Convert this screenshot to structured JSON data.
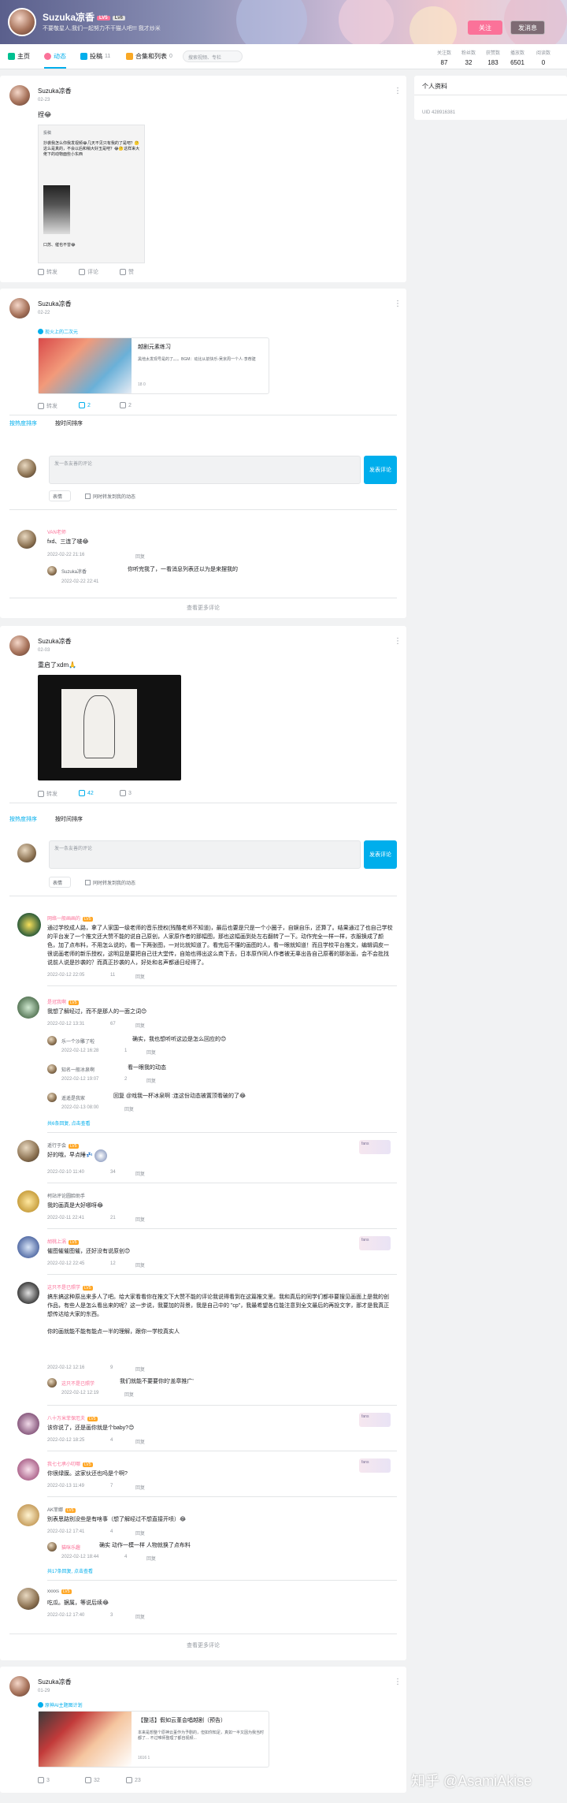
{
  "header": {
    "username": "Suzuka凉香",
    "level": "LV5",
    "vip": "Lv6",
    "sign": "不要敬星人,我们一起努力不干猫人吧!!! 我才炒米",
    "follow_label": "关注",
    "message_label": "发消息"
  },
  "nav": {
    "items": [
      {
        "label": "主页",
        "count": ""
      },
      {
        "label": "动态",
        "count": ""
      },
      {
        "label": "投稿",
        "count": "11"
      },
      {
        "label": "合集和列表",
        "count": "0"
      }
    ],
    "search_placeholder": "搜索视频、专栏"
  },
  "stats": [
    {
      "label": "关注数",
      "value": "87"
    },
    {
      "label": "粉丝数",
      "value": "32"
    },
    {
      "label": "获赞数",
      "value": "183"
    },
    {
      "label": "播放数",
      "value": "6501"
    },
    {
      "label": "阅读数",
      "value": "0"
    }
  ],
  "sidebar": {
    "title": "个人资料",
    "uid": "UID 428916381"
  },
  "post1": {
    "name": "Suzuka凉香",
    "time": "02-23",
    "text": "捏😂",
    "forward_text": "抄袭我怎么你我发视频😂几天不见只有我的了是吧？🤔这么是真的，不会以后和稍大好玉是吧？😂🤔这样来大佬下的动物面些小东西",
    "forward_author": "投稿",
    "forward_foot": "口苏、催也不曾😂",
    "actions": {
      "share": "转发",
      "comment": "评论",
      "like": "赞"
    }
  },
  "post2": {
    "name": "Suzuka凉香",
    "time": "02-22",
    "topic": "现火上的二次元",
    "article_title": "越剧元素练习",
    "article_desc": "黑他太发现号是的了。。。BGM：动比从前快乐-吴京周一个人·李荐建",
    "article_meta": "18  0",
    "actions": {
      "share": "转发",
      "comment": "2",
      "like": "2"
    },
    "sort_hot": "按热度排序",
    "sort_time": "按时间排序",
    "comment_placeholder": "发一条友善的评论",
    "send_label": "发表评论",
    "emoji_label": "表情",
    "forward_check": "同时转发到我的动态",
    "c1_name": "VAN老师",
    "c1_text": "fxd、三连了啵😂",
    "c1_time": "2022-02-22 21:16",
    "c1_reply": "回复",
    "r1_name": "Suzuka凉香",
    "r1_text": "你听完我了，一看消息列表还以为是来摆我的",
    "r1_time": "2022-02-22 22:41",
    "more_label": "查看更多评论"
  },
  "post3": {
    "name": "Suzuka凉香",
    "time": "02-03",
    "text": "重启了xdm🙏",
    "actions": {
      "share": "转发",
      "comment": "42",
      "like": "3"
    },
    "sort_hot": "按热度排序",
    "sort_time": "按时间排序",
    "comment_placeholder": "发一条友善的评论",
    "send_label": "发表评论",
    "emoji_label": "表情",
    "forward_check": "同时转发到我的动态",
    "comments": [
      {
        "name": "网络一般画画的",
        "text": "通过学校成人路，拿了人家国一级老师的音乐授权(残酷老师不知道)，最后也要是只是一个小圈子，自娱自乐，还算了。结果通过了也自己学校的平台发了一个推文还大赞不能的说自己原创，人家原作者的那幅图，那也这幅画到处左右翻转了一下。动作完全一样一样，衣服换成了颜色，加了点布料，不用怎么说的，看一下两张图，一对比就知道了。看完后不懂的画图的人，看一眼就知道！而且学校平台推文，编辑调皮一很说画老师的新乐授权，这明显是要把自己往大堂传，自始也得出这么商下去，日本原作同人作者被无辜出告自己原著的那张画，会不会批找说前人说是抄袭的？而真正抄袭的人，好处和名声都通日经得了。",
        "time": "2022-02-12 22:05",
        "likes": "11",
        "reply": "回复"
      },
      {
        "name": "是冠我啊",
        "text": "我想了解经过，而不是那人的一面之词😊",
        "time": "2022-02-12 13:31",
        "likes": "67",
        "reply": "回复"
      },
      {
        "name": "乐一个沙雕了啦",
        "text": "确实，我也想听听这边是怎么回应的😊",
        "time": "2022-02-12 16:28",
        "likes": "1",
        "reply": "回复"
      },
      {
        "name": "知名一般冰泉啊",
        "text": "看一眼我的动态",
        "time": "2022-02-12 19:07",
        "likes": "2",
        "reply": "回复"
      },
      {
        "name": "遥遥是我家",
        "text": "回复 @戏我一杯冰泉啊 :连这份动态被置顶看破的了😂",
        "time": "2022-02-13 08:00",
        "likes": "",
        "reply": "回复"
      },
      {
        "name": "共6条回复, 点击查看",
        "text": "",
        "time": "",
        "likes": "",
        "reply": ""
      },
      {
        "name": "遥行于会",
        "text": "好的哦，早点睡💤",
        "time": "2022-02-10 11:40",
        "likes": "34",
        "reply": "回复"
      },
      {
        "name": "柯站评论圆脸助手",
        "text": "我的画真是大好哪呀😂",
        "time": "2022-02-11 22:41",
        "likes": "21",
        "reply": "回复"
      },
      {
        "name": "胡桃上涡",
        "text": "催图催催图催，还好没有说原创😊",
        "time": "2022-02-12 22:45",
        "likes": "12",
        "reply": "回复"
      },
      {
        "name": "这只不是已照学",
        "text": "搞东搞这种原出来多人了吧。给大家看看你在推文下大赞不能的评论我说得看到在这篇推文里。我和真后的同学们都非要搜见画面上是我的创作品，有些人是怎么看出来的呢？这一步说，我要加的背景，我是自己中的 \"cp\"，我最希望各位能注意到全文最后的再投文字，那才是我真正想传达给大家的东西。\n\n你的画就能不能有能点一半的理解，跟你一学校真实人",
        "time": "2022-02-12 12:16",
        "likes": "9",
        "reply": "回复"
      },
      {
        "name": "这只不是已照学",
        "text": "我们就能不要要你的'盖章推广'",
        "time": "2022-02-12 12:19",
        "likes": "",
        "reply": "回复"
      },
      {
        "name": "八十万米菲保厄夫",
        "text": "该你说了，还是画你就是个baby?😊",
        "time": "2022-02-12 18:25",
        "likes": "4",
        "reply": "回复"
      },
      {
        "name": "我七七承小叨哪",
        "text": "你很绿膜。这家伙还也吗是个啊?",
        "time": "2022-02-13 11:49",
        "likes": "7",
        "reply": "回复"
      },
      {
        "name": "AK菲娜",
        "text": "别表思路别没些是有啥事（想了解经过不想直接开喷）😂",
        "time": "2022-02-12 17:41",
        "likes": "4",
        "reply": "回复"
      },
      {
        "name": "猫咪乐趣",
        "text": "确实 动作一模一样 人物就换了点布料",
        "time": "2022-02-12 18:44",
        "likes": "4",
        "reply": "回复"
      },
      {
        "name": "共17条回复, 点击查看",
        "text": "",
        "time": "",
        "likes": "",
        "reply": ""
      },
      {
        "name": "xxxxs",
        "text": "吃瓜。据属，等说后续😂",
        "time": "2022-02-12 17:40",
        "likes": "3",
        "reply": "回复"
      }
    ],
    "more_label": "查看更多评论"
  },
  "post4": {
    "name": "Suzuka凉香",
    "time": "01-29",
    "topic": "原神AI主题图计划",
    "article_title": "【整活】假如云堇会唱越剧（预告）",
    "article_desc": "本来是想整个原神云堇作为予剧的，但如你知足，真如一半又因为我当时都了... 不过唯师整理了都自视频...",
    "article_meta": "1616  1",
    "actions": {
      "share": "3",
      "comment": "32",
      "like": "23"
    }
  },
  "watermark": "知乎 @AsamiAkise"
}
